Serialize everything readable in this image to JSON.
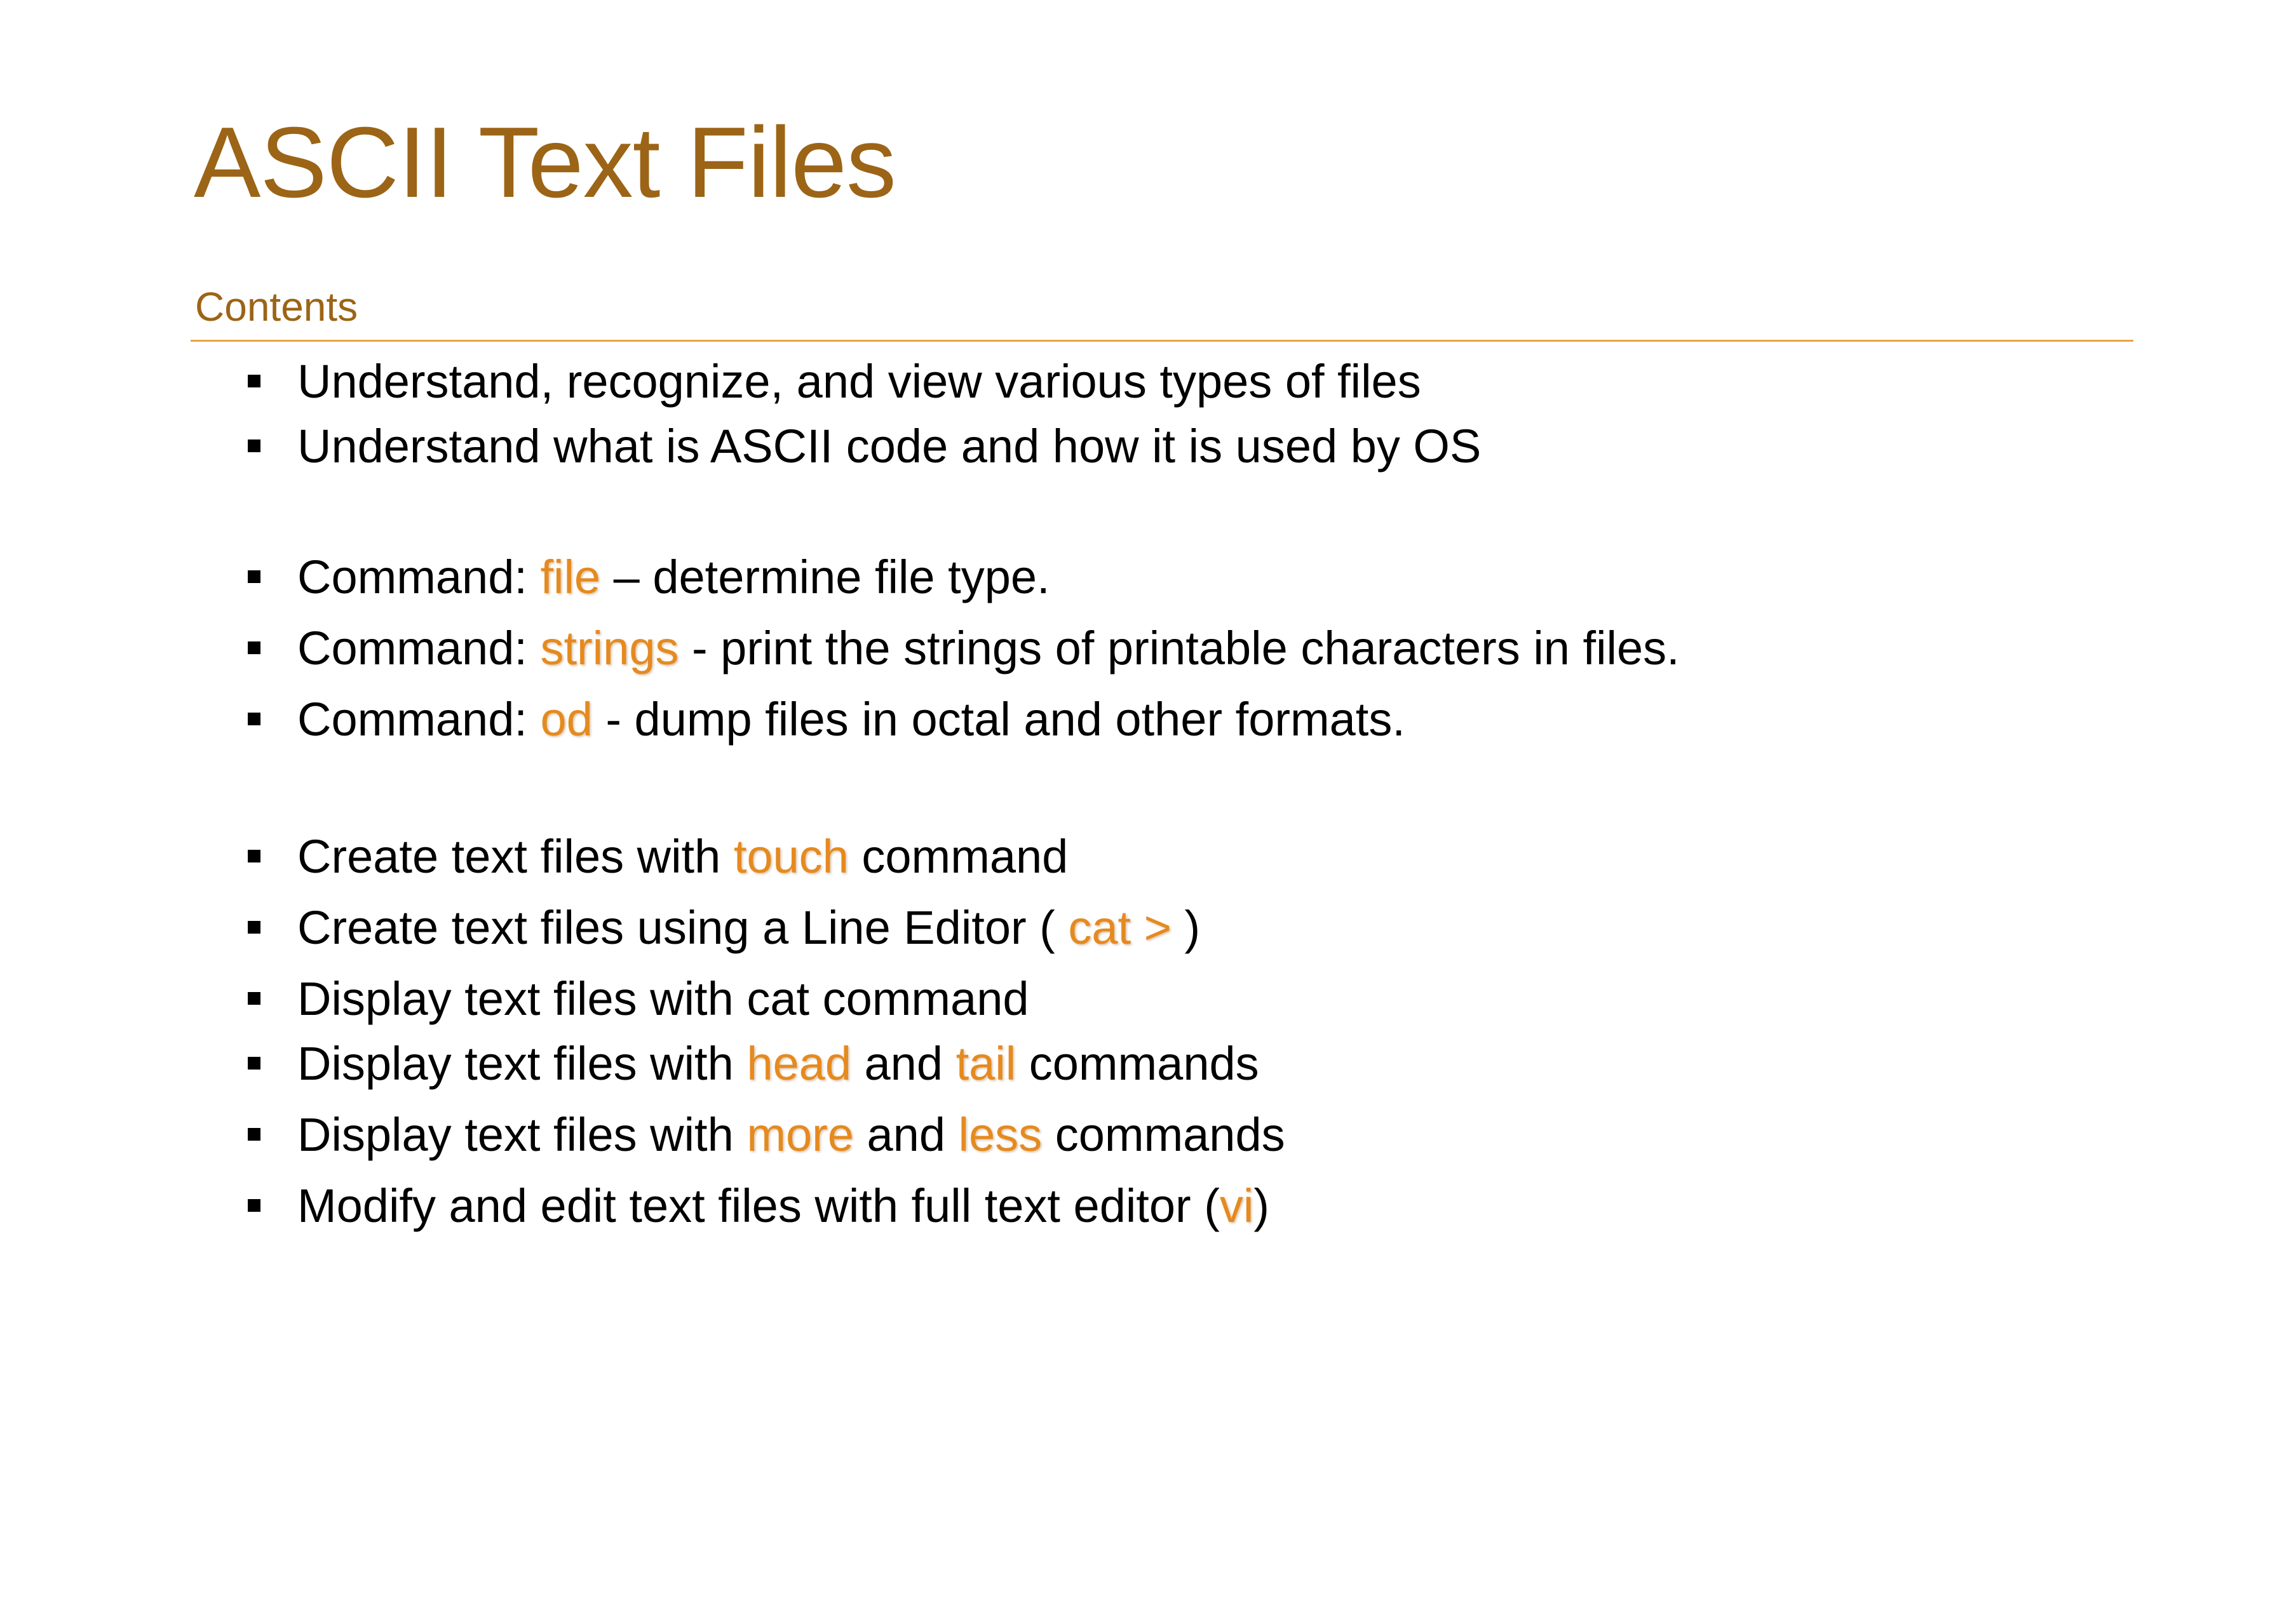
{
  "slide": {
    "title": "ASCII Text Files",
    "subheading": "Contents",
    "items": [
      {
        "before": "Understand, recognize, and view various types of files"
      },
      {
        "before": "Understand what is ASCII code and how it is used by OS"
      },
      {
        "before": "Command: ",
        "cmd": "file",
        "after": " – determine file type."
      },
      {
        "before": "Command: ",
        "cmd": "strings",
        "after": " -  print the strings of printable characters in files."
      },
      {
        "before": "Command: ",
        "cmd": "od",
        "after": " -  dump files in octal and other formats."
      },
      {
        "before": "Create text files with ",
        "cmd": "touch",
        "after": " command"
      },
      {
        "before": "Create text files using a Line Editor ( ",
        "cmd": "cat >",
        "after": " )"
      },
      {
        "before": "Display text files with cat command"
      },
      {
        "before": "Display text files with ",
        "cmd": "head",
        "mid": " and ",
        "cmd2": "tail",
        "after": " commands"
      },
      {
        "before": "Display text files with ",
        "cmd": "more",
        "mid": " and ",
        "cmd2": "less",
        "after": " commands"
      },
      {
        "before": "Modify and edit text files with full text editor (",
        "cmd": "vi",
        "after": ")"
      }
    ]
  },
  "colors": {
    "title": "#9c6416",
    "rule": "#e8a24a",
    "command_highlight": "#e58a1f",
    "body_text": "#000000",
    "background": "#ffffff"
  },
  "icons": {
    "bullet": "square-bullet-icon"
  }
}
